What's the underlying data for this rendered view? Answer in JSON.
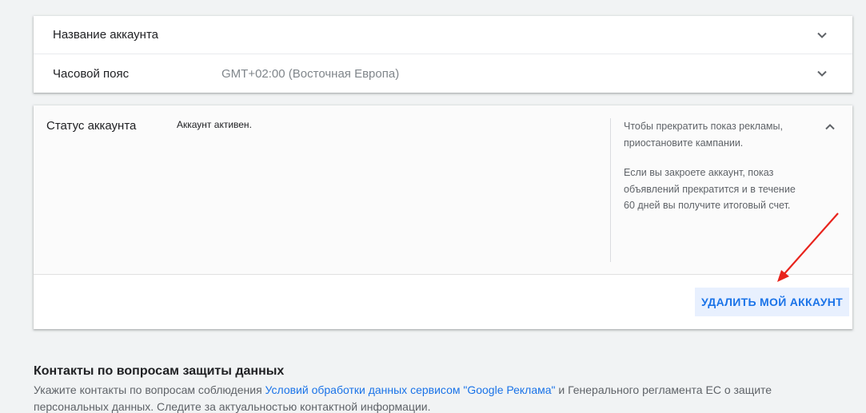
{
  "account_card": {
    "name_row": {
      "label": "Название аккаунта"
    },
    "timezone_row": {
      "label": "Часовой пояс",
      "value": "GMT+02:00 (Восточная Европа)"
    }
  },
  "status_card": {
    "label": "Статус аккаунта",
    "value": "Аккаунт активен.",
    "help_1": "Чтобы прекратить показ рекламы, приостановите кампании.",
    "help_2": "Если вы закроете аккаунт, показ объявлений прекратится и в течение 60 дней вы получите итоговый счет.",
    "delete_button": "УДАЛИТЬ МОЙ АККАУНТ"
  },
  "privacy_section": {
    "title": "Контакты по вопросам защиты данных",
    "desc_before": "Укажите контакты по вопросам соблюдения ",
    "link": "Условий обработки данных сервисом \"Google Реклама\"",
    "desc_after": " и Генерального регламента ЕС о защите персональных данных. Следите за актуальностью контактной информации."
  },
  "colors": {
    "background": "#f1f3f4",
    "accent": "#1a73e8",
    "button_bg": "#e8f0fe",
    "annotation_arrow": "#e8231c"
  },
  "icons": [
    "chevron-down-icon",
    "chevron-up-icon"
  ]
}
